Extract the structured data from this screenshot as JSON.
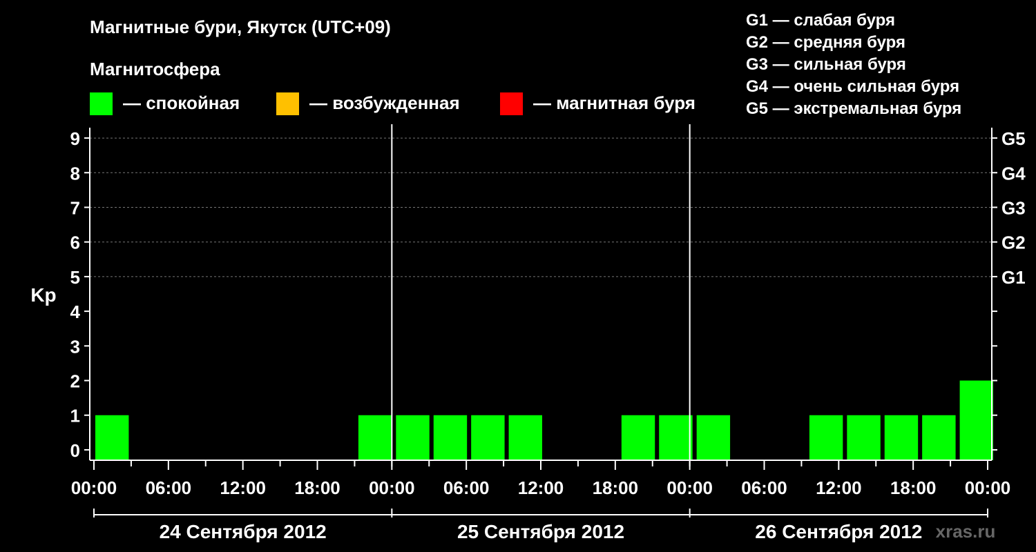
{
  "header": {
    "title": "Магнитные бури, Якутск (UTC+09)",
    "magnetosphere_label": "Магнитосфера"
  },
  "legend": {
    "states": [
      {
        "label": "— спокойная",
        "color": "#00ff00"
      },
      {
        "label": "— возбужденная",
        "color": "#ffc000"
      },
      {
        "label": "— магнитная буря",
        "color": "#ff0000"
      }
    ],
    "storm_levels": [
      "G1 — слабая буря",
      "G2 — средняя буря",
      "G3 — сильная буря",
      "G4 — очень сильная буря",
      "G5 — экстремальная буря"
    ]
  },
  "watermark": "xras.ru",
  "chart_data": {
    "type": "bar",
    "ylabel": "Kp",
    "ylim": [
      -0.3,
      9.3
    ],
    "y_ticks": [
      0,
      1,
      2,
      3,
      4,
      5,
      6,
      7,
      8,
      9
    ],
    "right_axis_labels": [
      {
        "kp": 5,
        "label": "G1"
      },
      {
        "kp": 6,
        "label": "G2"
      },
      {
        "kp": 7,
        "label": "G3"
      },
      {
        "kp": 8,
        "label": "G4"
      },
      {
        "kp": 9,
        "label": "G5"
      }
    ],
    "grid": "dashed horizontal at Kp 5-9",
    "x_tick_labels": [
      "00:00",
      "06:00",
      "12:00",
      "18:00",
      "00:00",
      "06:00",
      "12:00",
      "18:00",
      "00:00",
      "06:00",
      "12:00",
      "18:00",
      "00:00"
    ],
    "days": [
      "24 Сентября 2012",
      "25 Сентября 2012",
      "26 Сентября 2012"
    ],
    "interval_hours": 3,
    "values": [
      1,
      0,
      0,
      0,
      0,
      0,
      0,
      1,
      1,
      1,
      1,
      1,
      0,
      0,
      1,
      1,
      1,
      0,
      0,
      1,
      1,
      1,
      1,
      2
    ],
    "bar_color": "#00ff00"
  }
}
